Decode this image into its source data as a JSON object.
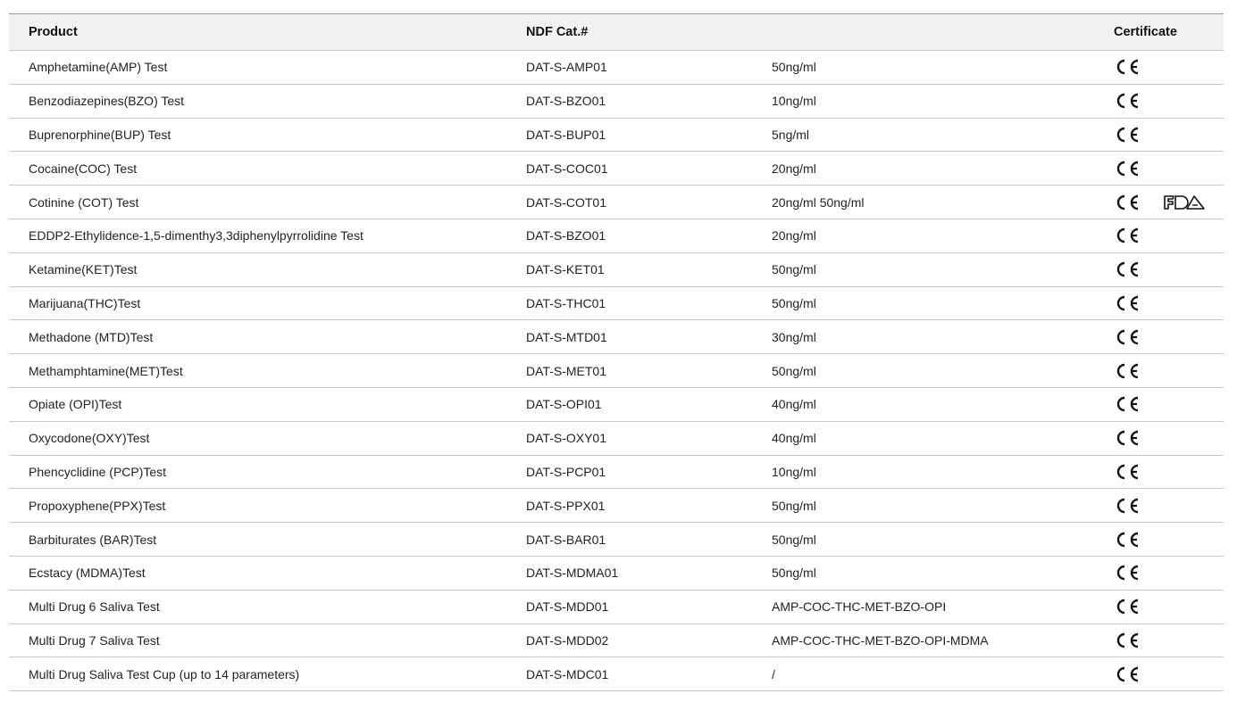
{
  "header": {
    "product": "Product",
    "cat": "NDF Cat.#",
    "cutoff": "",
    "certificate": "Certificate"
  },
  "icons": {
    "ce": "ce-mark-icon",
    "fda": "fda-logo-icon"
  },
  "rows": [
    {
      "product": "Amphetamine(AMP) Test",
      "cat": "DAT-S-AMP01",
      "cutoff": "50ng/ml",
      "certs": [
        "CE"
      ]
    },
    {
      "product": "Benzodiazepines(BZO) Test",
      "cat": "DAT-S-BZO01",
      "cutoff": "10ng/ml",
      "certs": [
        "CE"
      ]
    },
    {
      "product": "Buprenorphine(BUP) Test",
      "cat": "DAT-S-BUP01",
      "cutoff": "5ng/ml",
      "certs": [
        "CE"
      ]
    },
    {
      "product": "Cocaine(COC) Test",
      "cat": "DAT-S-COC01",
      "cutoff": "20ng/ml",
      "certs": [
        "CE"
      ]
    },
    {
      "product": "Cotinine (COT) Test",
      "cat": "DAT-S-COT01",
      "cutoff": "20ng/ml 50ng/ml",
      "certs": [
        "CE",
        "FDA"
      ]
    },
    {
      "product": "EDDP2-Ethylidence-1,5-dimenthy3,3diphenylpyrrolidine Test",
      "cat": "DAT-S-BZO01",
      "cutoff": "20ng/ml",
      "certs": [
        "CE"
      ]
    },
    {
      "product": "Ketamine(KET)Test",
      "cat": "DAT-S-KET01",
      "cutoff": "50ng/ml",
      "certs": [
        "CE"
      ]
    },
    {
      "product": "Marijuana(THC)Test",
      "cat": "DAT-S-THC01",
      "cutoff": "50ng/ml",
      "certs": [
        "CE"
      ]
    },
    {
      "product": "Methadone (MTD)Test",
      "cat": "DAT-S-MTD01",
      "cutoff": "30ng/ml",
      "certs": [
        "CE"
      ]
    },
    {
      "product": "Methamphtamine(MET)Test",
      "cat": "DAT-S-MET01",
      "cutoff": "50ng/ml",
      "certs": [
        "CE"
      ]
    },
    {
      "product": "Opiate (OPI)Test",
      "cat": "DAT-S-OPI01",
      "cutoff": "40ng/ml",
      "certs": [
        "CE"
      ]
    },
    {
      "product": "Oxycodone(OXY)Test",
      "cat": "DAT-S-OXY01",
      "cutoff": "40ng/ml",
      "certs": [
        "CE"
      ]
    },
    {
      "product": "Phencyclidine (PCP)Test",
      "cat": "DAT-S-PCP01",
      "cutoff": "10ng/ml",
      "certs": [
        "CE"
      ]
    },
    {
      "product": "Propoxyphene(PPX)Test",
      "cat": "DAT-S-PPX01",
      "cutoff": "50ng/ml",
      "certs": [
        "CE"
      ]
    },
    {
      "product": "Barbiturates (BAR)Test",
      "cat": "DAT-S-BAR01",
      "cutoff": "50ng/ml",
      "certs": [
        "CE"
      ]
    },
    {
      "product": "Ecstacy (MDMA)Test",
      "cat": "DAT-S-MDMA01",
      "cutoff": "50ng/ml",
      "certs": [
        "CE"
      ]
    },
    {
      "product": "Multi Drug 6 Saliva Test",
      "cat": "DAT-S-MDD01",
      "cutoff": "AMP-COC-THC-MET-BZO-OPI",
      "certs": [
        "CE"
      ]
    },
    {
      "product": "Multi Drug 7 Saliva Test",
      "cat": "DAT-S-MDD02",
      "cutoff": "AMP-COC-THC-MET-BZO-OPI-MDMA",
      "certs": [
        "CE"
      ]
    },
    {
      "product": "Multi Drug Saliva Test Cup (up to 14 parameters)",
      "cat": "DAT-S-MDC01",
      "cutoff": "/",
      "certs": [
        "CE"
      ]
    }
  ]
}
